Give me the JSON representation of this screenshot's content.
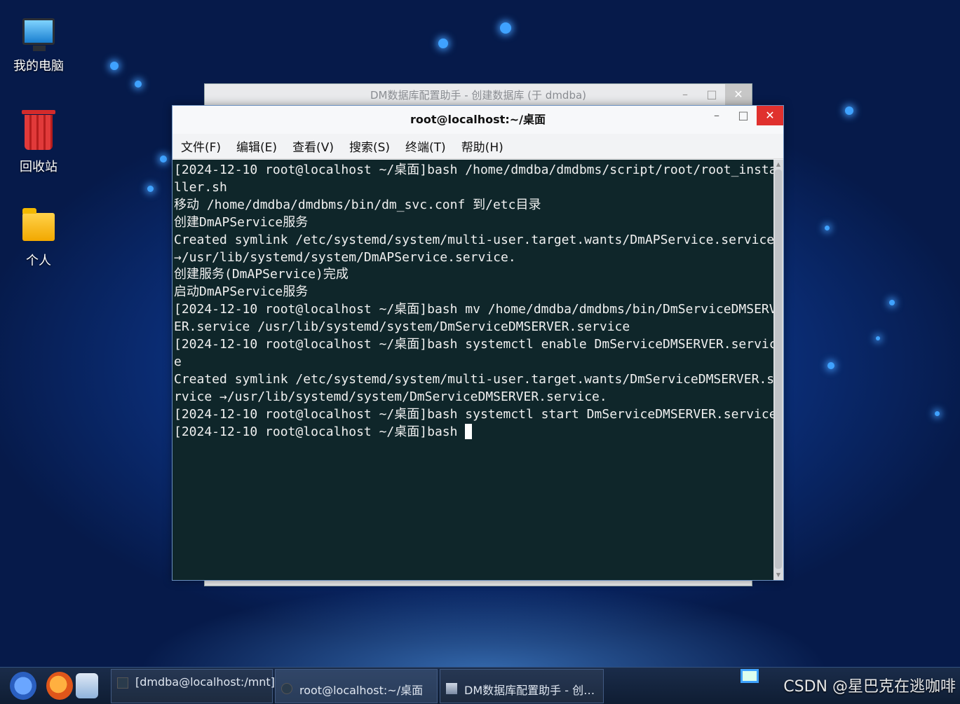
{
  "desktop": {
    "icons": [
      {
        "label": "我的电脑",
        "icon": "computer-icon"
      },
      {
        "label": "回收站",
        "icon": "trash-icon"
      },
      {
        "label": "个人",
        "icon": "home-folder-icon"
      }
    ]
  },
  "back_window": {
    "title": "DM数据库配置助手 - 创建数据库 (于 dmdba)",
    "minimize": "–",
    "maximize": "□",
    "close": "✕"
  },
  "terminal": {
    "title": "root@localhost:~/桌面",
    "minimize": "–",
    "maximize": "□",
    "close": "✕",
    "menu": [
      "文件(F)",
      "编辑(E)",
      "查看(V)",
      "搜索(S)",
      "终端(T)",
      "帮助(H)"
    ],
    "lines": [
      "[2024-12-10 root@localhost ~/桌面]bash /home/dmdba/dmdbms/script/root/root_insta",
      "ller.sh",
      "移动 /home/dmdba/dmdbms/bin/dm_svc.conf 到/etc目录",
      "创建DmAPService服务",
      "Created symlink /etc/systemd/system/multi-user.target.wants/DmAPService.service",
      "→/usr/lib/systemd/system/DmAPService.service.",
      "创建服务(DmAPService)完成",
      "启动DmAPService服务",
      "[2024-12-10 root@localhost ~/桌面]bash mv /home/dmdba/dmdbms/bin/DmServiceDMSERV",
      "ER.service /usr/lib/systemd/system/DmServiceDMSERVER.service",
      "[2024-12-10 root@localhost ~/桌面]bash systemctl enable DmServiceDMSERVER.servic",
      "e",
      "Created symlink /etc/systemd/system/multi-user.target.wants/DmServiceDMSERVER.se",
      "rvice →/usr/lib/systemd/system/DmServiceDMSERVER.service.",
      "[2024-12-10 root@localhost ~/桌面]bash systemctl start DmServiceDMSERVER.service"
    ],
    "prompt": "[2024-12-10 root@localhost ~/桌面]bash "
  },
  "taskbar": {
    "tasks": [
      {
        "label": "[dmdba@localhost:/mnt]",
        "icon": "terminal-icon"
      },
      {
        "label": "root@localhost:~/桌面",
        "icon": "terminal-icon"
      },
      {
        "label": "DM数据库配置助手 - 创…",
        "icon": "app-icon"
      }
    ]
  },
  "watermark": "CSDN @星巴克在逃咖啡"
}
